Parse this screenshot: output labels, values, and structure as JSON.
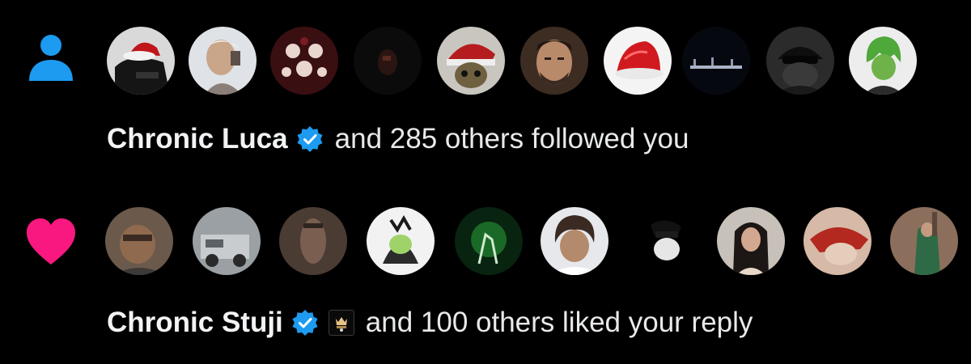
{
  "notifications": [
    {
      "type": "follow",
      "icon": "person-icon",
      "icon_color": "#1d9bf0",
      "name": "Chronic Luca",
      "verified": true,
      "rest_text": "and 285 others followed you",
      "avatar_count": 10
    },
    {
      "type": "like",
      "icon": "heart-icon",
      "icon_color": "#f91880",
      "name": "Chronic Stuji",
      "verified": true,
      "affiliate_badge": "crown-badge-icon",
      "rest_text": "and 100 others liked your reply",
      "avatar_count": 10
    }
  ],
  "colors": {
    "background": "#000000",
    "text": "#e7e9ea",
    "verified_blue": "#1d9bf0"
  }
}
